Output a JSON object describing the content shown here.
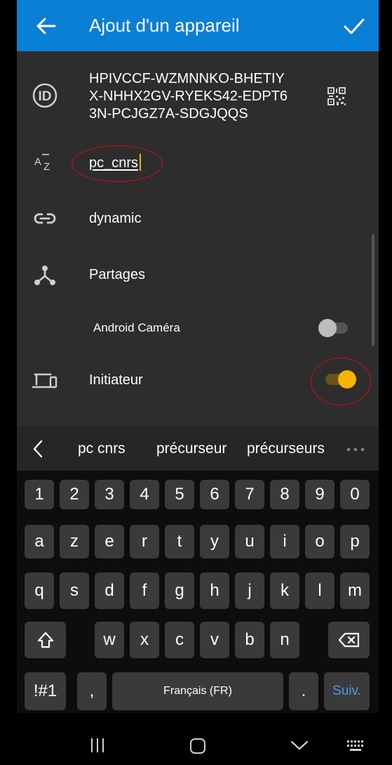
{
  "appbar": {
    "title": "Ajout d'un appareil",
    "back_icon": "arrow-left-icon",
    "confirm_icon": "check-icon"
  },
  "form": {
    "device_id_lines": [
      "HPIVCCF-WZMNNKO-BHETIY",
      "X-NHHX2GV-RYEKS42-EDPT6",
      "3N-PCJGZ7A-SDGJQQS"
    ],
    "name_value": "pc_cnrs",
    "address": "dynamic",
    "shares_label": "Partages",
    "share_folder": "Android Caméra",
    "introducer_label": "Initiateur"
  },
  "toggles": {
    "android_camera_on": false,
    "introducer_on": true
  },
  "colors": {
    "accent": "#0a7fd6",
    "toggle_on": "#f4b400",
    "annotation": "#d01010",
    "next_key": "#4f9bea"
  },
  "suggestions": [
    "pc cnrs",
    "précurseur",
    "précurseurs"
  ],
  "keyboard": {
    "row1": [
      "1",
      "2",
      "3",
      "4",
      "5",
      "6",
      "7",
      "8",
      "9",
      "0"
    ],
    "row2": [
      "a",
      "z",
      "e",
      "r",
      "t",
      "y",
      "u",
      "i",
      "o",
      "p"
    ],
    "row3": [
      "q",
      "s",
      "d",
      "f",
      "g",
      "h",
      "j",
      "k",
      "l",
      "m"
    ],
    "row4": [
      "w",
      "x",
      "c",
      "v",
      "b",
      "n"
    ],
    "symbols": "!#1",
    "comma": ",",
    "space": "Français (FR)",
    "period": ".",
    "next": "Suiv."
  }
}
